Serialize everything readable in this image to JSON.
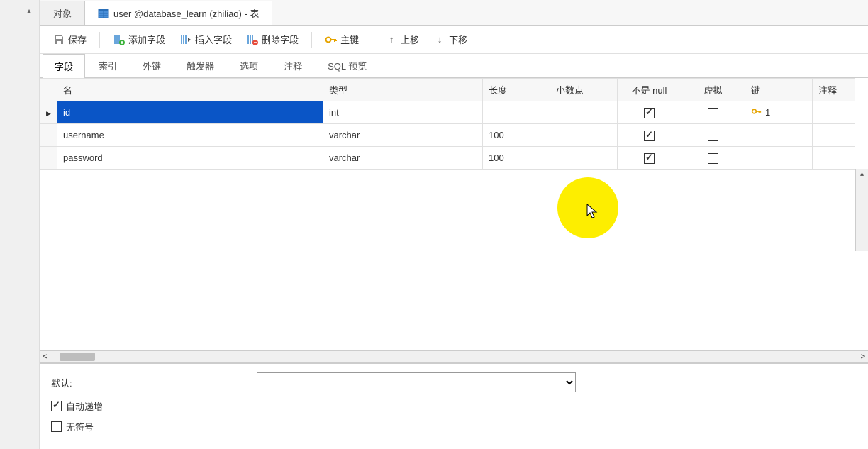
{
  "tabs": [
    {
      "label": "对象",
      "active": false
    },
    {
      "label": "user @database_learn (zhiliao) - 表",
      "active": true
    }
  ],
  "toolbar": {
    "save": "保存",
    "add_field": "添加字段",
    "insert_field": "插入字段",
    "delete_field": "删除字段",
    "primary_key": "主键",
    "move_up": "上移",
    "move_down": "下移"
  },
  "sub_tabs": [
    "字段",
    "索引",
    "外键",
    "触发器",
    "选项",
    "注释",
    "SQL 预览"
  ],
  "sub_tab_active": 0,
  "columns": {
    "name": "名",
    "type": "类型",
    "length": "长度",
    "decimals": "小数点",
    "not_null": "不是 null",
    "virtual": "虚拟",
    "key": "键",
    "comment": "注释"
  },
  "rows": [
    {
      "name": "id",
      "type": "int",
      "length": "",
      "decimals": "",
      "not_null": true,
      "virtual": false,
      "key": "1",
      "selected": true
    },
    {
      "name": "username",
      "type": "varchar",
      "length": "100",
      "decimals": "",
      "not_null": true,
      "virtual": false,
      "key": "",
      "selected": false
    },
    {
      "name": "password",
      "type": "varchar",
      "length": "100",
      "decimals": "",
      "not_null": true,
      "virtual": false,
      "key": "",
      "selected": false
    }
  ],
  "bottom": {
    "default_label": "默认:",
    "default_value": "",
    "auto_increment": "自动递增",
    "auto_increment_checked": true,
    "unsigned": "无符号",
    "unsigned_checked": false
  }
}
